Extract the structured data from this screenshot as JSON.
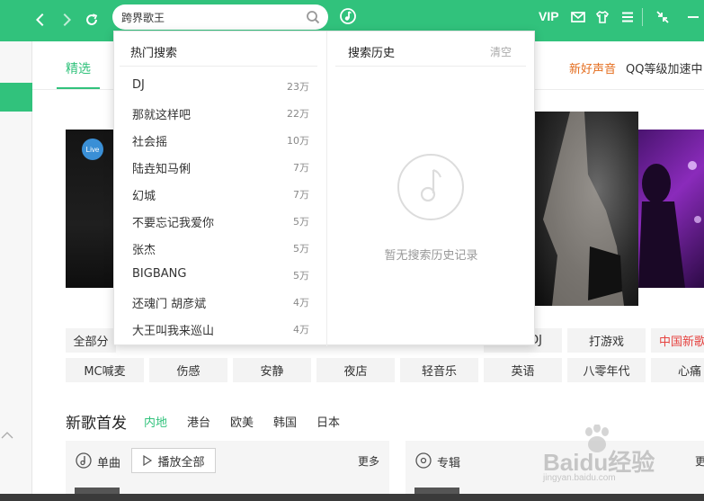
{
  "header": {
    "search_value": "跨界歌王",
    "vip_label": "VIP"
  },
  "tabs": {
    "selected": "精选",
    "new_voice": "新好声音",
    "qq_level": "QQ等级加速中"
  },
  "banner": {
    "live_badge": "Live"
  },
  "search_dropdown": {
    "hot_title": "热门搜索",
    "hot_items": [
      {
        "name": "DJ",
        "count": "23万"
      },
      {
        "name": "那就这样吧",
        "count": "22万"
      },
      {
        "name": "社会摇",
        "count": "10万"
      },
      {
        "name": "陆垚知马俐",
        "count": "7万"
      },
      {
        "name": "幻城",
        "count": "7万"
      },
      {
        "name": "不要忘记我爱你",
        "count": "5万"
      },
      {
        "name": "张杰",
        "count": "5万"
      },
      {
        "name": "BIGBANG",
        "count": "5万"
      },
      {
        "name": "还魂门 胡彦斌",
        "count": "4万"
      },
      {
        "name": "大王叫我来巡山",
        "count": "4万"
      }
    ],
    "history_title": "搜索历史",
    "history_clear": "清空",
    "history_empty": "暂无搜索历史记录"
  },
  "tags": {
    "row1": [
      "全部分",
      "DJ",
      "打游戏",
      "中国新歌"
    ],
    "row2": [
      "MC喊麦",
      "伤感",
      "安静",
      "夜店",
      "轻音乐",
      "英语",
      "八零年代",
      "心痛"
    ]
  },
  "new_songs": {
    "title": "新歌首发",
    "regions": [
      "内地",
      "港台",
      "欧美",
      "韩国",
      "日本"
    ],
    "single_label": "单曲",
    "play_all": "播放全部",
    "more": "更多",
    "album_label": "专辑",
    "album_more": "更"
  },
  "watermark": {
    "brand": "Baidu经验",
    "url": "jingyan.baidu.com"
  }
}
